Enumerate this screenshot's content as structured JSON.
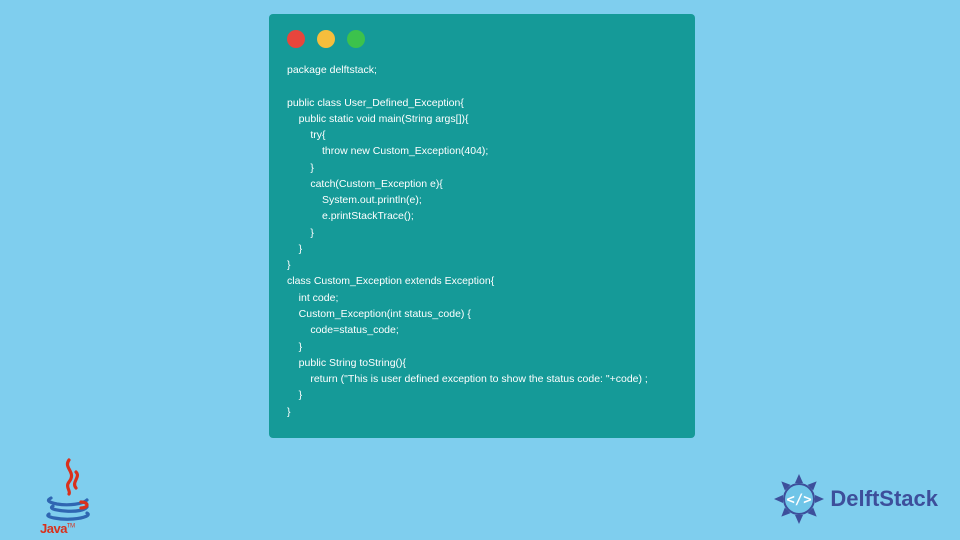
{
  "code": {
    "lines": [
      "package delftstack;",
      "",
      "public class User_Defined_Exception{",
      "    public static void main(String args[]){",
      "        try{",
      "            throw new Custom_Exception(404);",
      "        }",
      "        catch(Custom_Exception e){",
      "            System.out.println(e);",
      "            e.printStackTrace();",
      "        }",
      "    }",
      "}",
      "class Custom_Exception extends Exception{",
      "    int code;",
      "    Custom_Exception(int status_code) {",
      "        code=status_code;",
      "    }",
      "    public String toString(){",
      "        return (\"This is user defined exception to show the status code: \"+code) ;",
      "    }",
      "}"
    ]
  },
  "logos": {
    "java_label": "Java",
    "java_tm": "TM",
    "delft_label": "DelftStack"
  },
  "colors": {
    "background": "#7fceee",
    "window": "#159a98",
    "text": "#ffffff",
    "red": "#e7453c",
    "yellow": "#f6be3c",
    "green": "#3cc24c",
    "delft_blue": "#3d4f9b"
  }
}
